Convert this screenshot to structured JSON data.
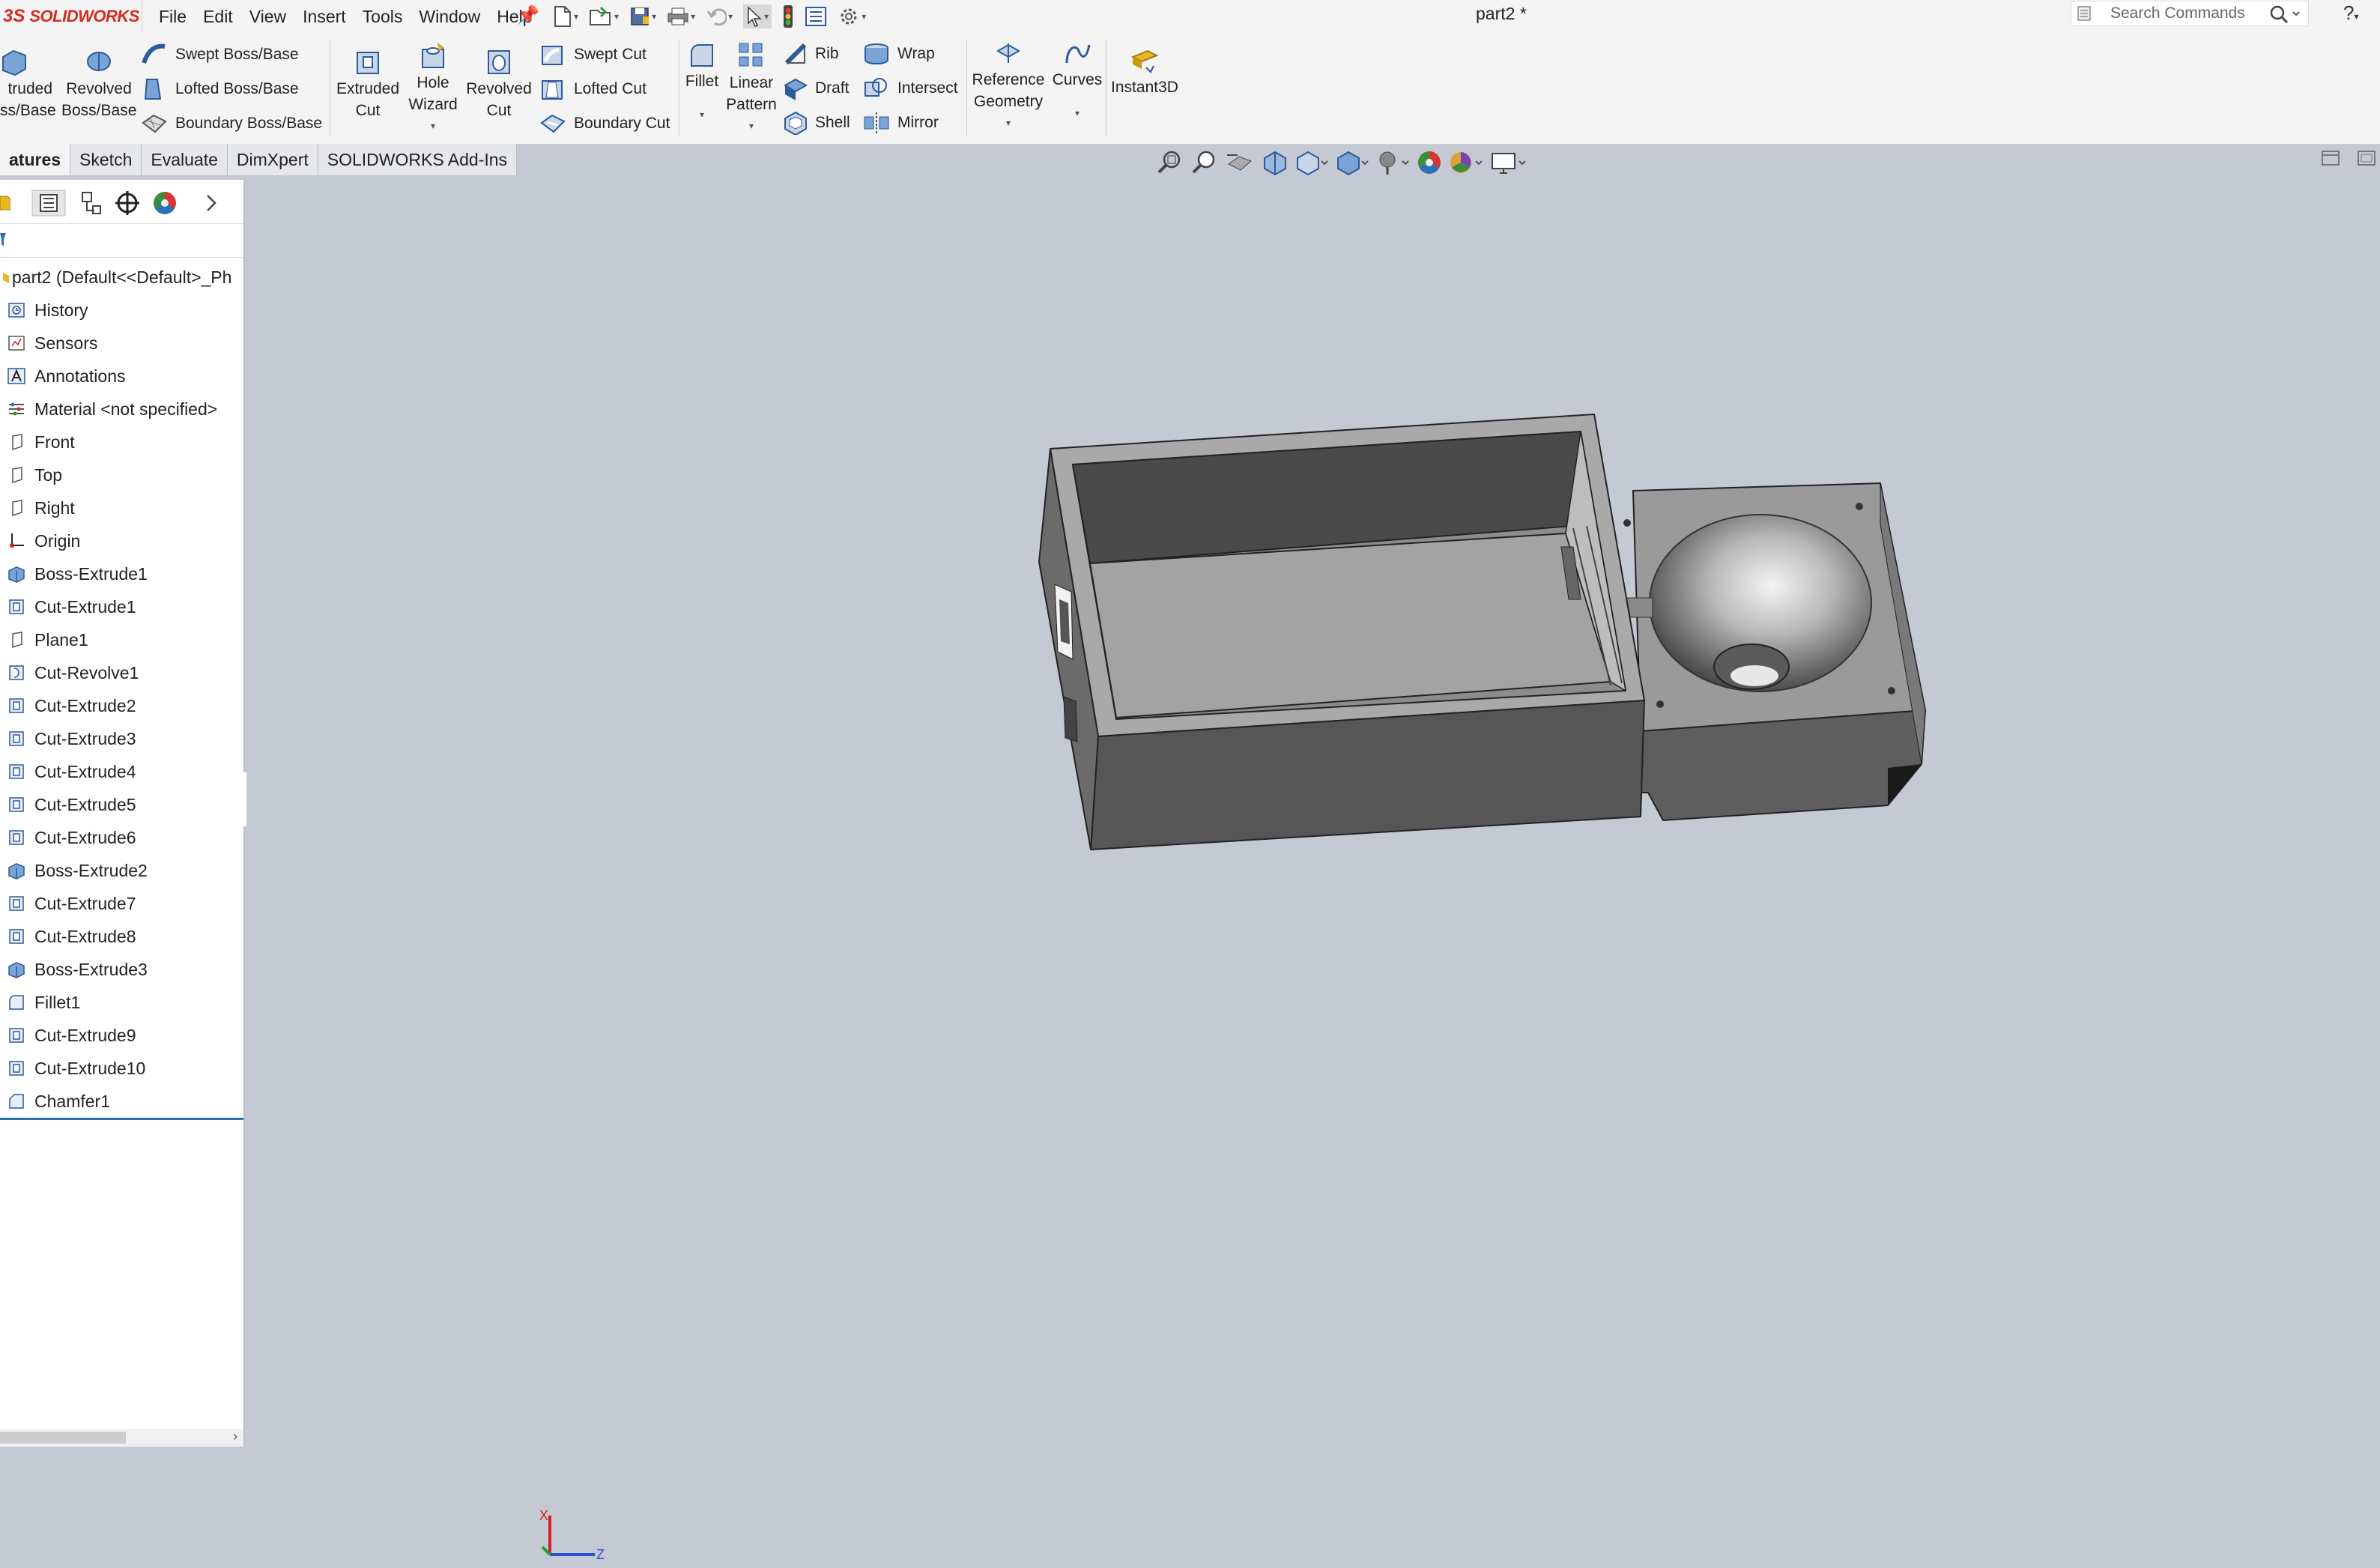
{
  "app": {
    "logo_ds": "3S",
    "logo_name": "SOLIDWORKS",
    "document_title": "part2 *"
  },
  "menu": [
    "File",
    "Edit",
    "View",
    "Insert",
    "Tools",
    "Window",
    "Help"
  ],
  "search": {
    "placeholder": "Search Commands"
  },
  "help_label": "?",
  "ribbon": {
    "extruded_boss": [
      "truded",
      "ss/Base"
    ],
    "revolved_boss": [
      "Revolved",
      "Boss/Base"
    ],
    "swept_boss": "Swept Boss/Base",
    "lofted_boss": "Lofted Boss/Base",
    "boundary_boss": "Boundary Boss/Base",
    "extruded_cut": [
      "Extruded",
      "Cut"
    ],
    "hole_wizard": [
      "Hole",
      "Wizard"
    ],
    "revolved_cut": [
      "Revolved",
      "Cut"
    ],
    "swept_cut": "Swept Cut",
    "lofted_cut": "Lofted Cut",
    "boundary_cut": "Boundary Cut",
    "fillet": "Fillet",
    "linear_pattern": [
      "Linear",
      "Pattern"
    ],
    "rib": "Rib",
    "draft": "Draft",
    "shell": "Shell",
    "wrap": "Wrap",
    "intersect": "Intersect",
    "mirror": "Mirror",
    "reference_geometry": [
      "Reference",
      "Geometry"
    ],
    "curves": "Curves",
    "instant3d": "Instant3D"
  },
  "tabs": [
    "atures",
    "Sketch",
    "Evaluate",
    "DimXpert",
    "SOLIDWORKS Add-Ins"
  ],
  "feature_tree": {
    "root": "part2  (Default<<Default>_Ph",
    "items": [
      {
        "label": "History",
        "icon": "history-icon"
      },
      {
        "label": "Sensors",
        "icon": "sensors-icon"
      },
      {
        "label": "Annotations",
        "icon": "annotations-icon"
      },
      {
        "label": "Material <not specified>",
        "icon": "material-icon"
      },
      {
        "label": "Front",
        "icon": "plane-icon"
      },
      {
        "label": "Top",
        "icon": "plane-icon"
      },
      {
        "label": "Right",
        "icon": "plane-icon"
      },
      {
        "label": "Origin",
        "icon": "origin-icon"
      },
      {
        "label": "Boss-Extrude1",
        "icon": "boss-extrude-icon"
      },
      {
        "label": "Cut-Extrude1",
        "icon": "cut-extrude-icon"
      },
      {
        "label": "Plane1",
        "icon": "plane-icon"
      },
      {
        "label": "Cut-Revolve1",
        "icon": "cut-revolve-icon"
      },
      {
        "label": "Cut-Extrude2",
        "icon": "cut-extrude-icon"
      },
      {
        "label": "Cut-Extrude3",
        "icon": "cut-extrude-icon"
      },
      {
        "label": "Cut-Extrude4",
        "icon": "cut-extrude-icon"
      },
      {
        "label": "Cut-Extrude5",
        "icon": "cut-extrude-icon"
      },
      {
        "label": "Cut-Extrude6",
        "icon": "cut-extrude-icon"
      },
      {
        "label": "Boss-Extrude2",
        "icon": "boss-extrude-icon"
      },
      {
        "label": "Cut-Extrude7",
        "icon": "cut-extrude-icon"
      },
      {
        "label": "Cut-Extrude8",
        "icon": "cut-extrude-icon"
      },
      {
        "label": "Boss-Extrude3",
        "icon": "boss-extrude-icon"
      },
      {
        "label": "Fillet1",
        "icon": "fillet-icon"
      },
      {
        "label": "Cut-Extrude9",
        "icon": "cut-extrude-icon"
      },
      {
        "label": "Cut-Extrude10",
        "icon": "cut-extrude-icon"
      },
      {
        "label": "Chamfer1",
        "icon": "chamfer-icon"
      }
    ]
  },
  "triad": {
    "x_label": "X",
    "z_label": "Z"
  },
  "colors": {
    "viewport_bg": "#c5c9d3",
    "brand_red": "#d52b1e",
    "selection_blue": "#2d6fbf",
    "model_gray": "#8e8e8e"
  }
}
